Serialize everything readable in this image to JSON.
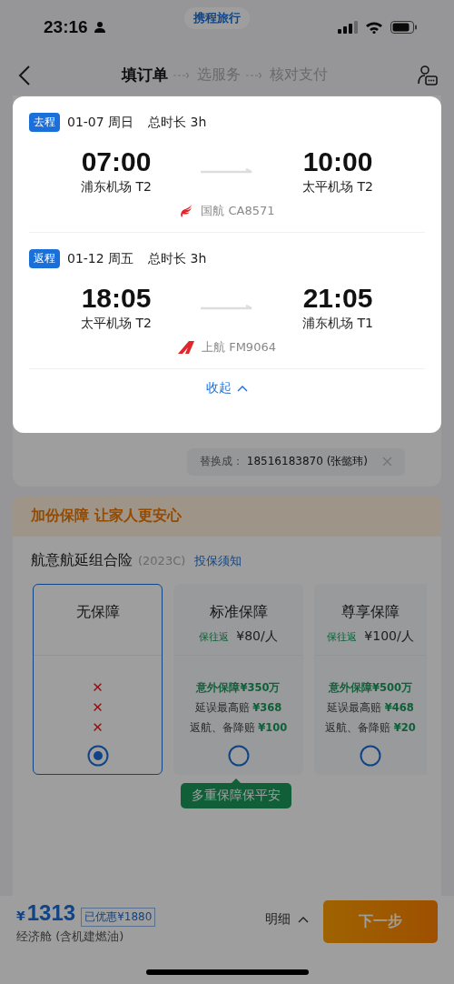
{
  "status_bar": {
    "time": "23:16",
    "app_badge": "携程旅行"
  },
  "nav": {
    "steps": [
      {
        "label": "填订单",
        "selected": true
      },
      {
        "label": "选服务",
        "selected": false
      },
      {
        "label": "核对支付",
        "selected": false
      }
    ]
  },
  "flight_popup": {
    "segments": [
      {
        "tag": "去程",
        "date": "01-07 周日",
        "duration": "总时长 3h",
        "depart_time": "07:00",
        "depart_airport": "浦东机场 T2",
        "arrive_time": "10:00",
        "arrive_airport": "太平机场 T2",
        "airline": "国航 CA8571",
        "kind": "phoenix"
      },
      {
        "tag": "返程",
        "date": "01-12 周五",
        "duration": "总时长 3h",
        "depart_time": "18:05",
        "depart_airport": "太平机场 T2",
        "arrive_time": "21:05",
        "arrive_airport": "浦东机场 T1",
        "airline": "上航 FM9064",
        "kind": "wing"
      }
    ],
    "collapse": "收起"
  },
  "contact": {
    "replace_label": "替换成：",
    "replace_value": "18516183870 (张懿玮)"
  },
  "banner": "加份保障 让家人更安心",
  "insurance": {
    "title": "航意航延组合险",
    "code": "(2023C)",
    "link": "投保须知",
    "plans": [
      {
        "kind": "none",
        "name": "无保障",
        "selected": true,
        "marks": [
          "✕",
          "✕",
          "✕"
        ]
      },
      {
        "kind": "cover",
        "name": "标准保障",
        "tag": "保往返",
        "price": "¥80/人",
        "features": [
          "**意外保障¥350万**",
          "延误最高赔 **¥368**",
          "返航、备降赔 **¥100**"
        ],
        "selected": false
      },
      {
        "kind": "cover",
        "name": "尊享保障",
        "tag": "保往返",
        "price": "¥100/人",
        "features": [
          "**意外保障¥500万**",
          "延误最高赔 **¥468**",
          "返航、备降赔 **¥20**"
        ],
        "selected": false
      }
    ],
    "tooltip": "多重保障保平安"
  },
  "bottom_bar": {
    "currency": "¥",
    "amount": "1313",
    "discount": "已优惠¥1880",
    "cabin": "经济舱 (含机建燃油)",
    "detail": "明细",
    "next": "下一步"
  }
}
